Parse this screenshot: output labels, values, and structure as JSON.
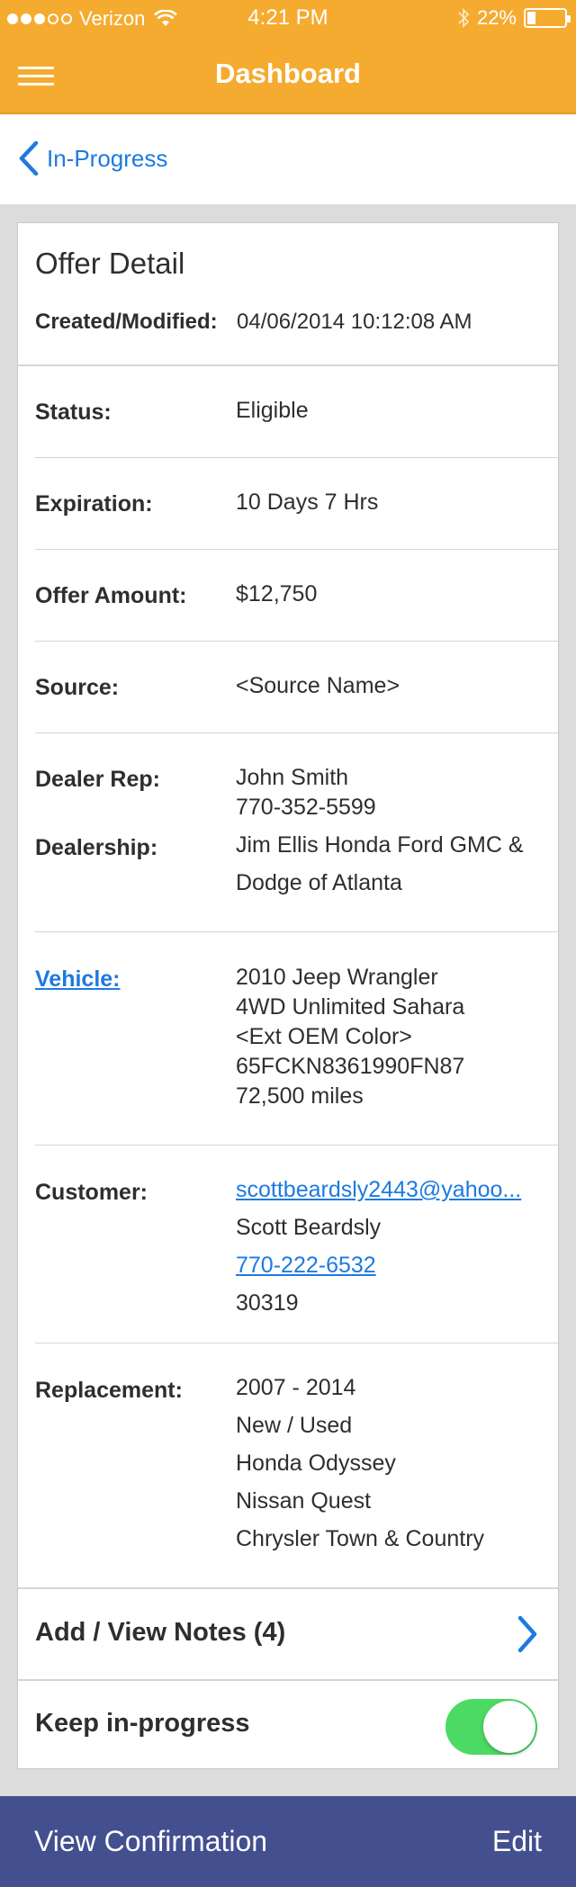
{
  "status_bar": {
    "carrier": "Verizon",
    "time": "4:21 PM",
    "battery": "22%",
    "battery_level": 0.22
  },
  "header": {
    "title": "Dashboard"
  },
  "back": {
    "label": "In-Progress"
  },
  "offer": {
    "title": "Offer Detail",
    "created_label": "Created/Modified:",
    "created_value": "04/06/2014  10:12:08 AM",
    "status_label": "Status:",
    "status_value": "Eligible",
    "expiration_label": "Expiration:",
    "expiration_value": "10 Days 7 Hrs",
    "amount_label": "Offer Amount:",
    "amount_value": "$12,750",
    "source_label": "Source:",
    "source_value": "<Source Name>",
    "dealer_rep_label": "Dealer Rep:",
    "dealer_rep_name": "John Smith",
    "dealer_rep_phone": "770-352-5599",
    "dealership_label": "Dealership:",
    "dealership_line1": "Jim Ellis Honda Ford GMC &",
    "dealership_line2": "Dodge of Atlanta",
    "vehicle_label": "Vehicle:",
    "vehicle_lines": [
      "2010 Jeep Wrangler",
      "4WD Unlimited Sahara",
      "<Ext OEM Color>",
      "65FCKN8361990FN87",
      "72,500 miles"
    ],
    "customer_label": "Customer:",
    "customer_email": "scottbeardsly2443@yahoo...",
    "customer_name": "Scott Beardsly",
    "customer_phone": "770-222-6532",
    "customer_zip": "30319",
    "replacement_label": "Replacement:",
    "replacement_lines": [
      "2007 - 2014",
      "New / Used",
      "Honda Odyssey",
      "Nissan Quest",
      "Chrysler Town & Country"
    ],
    "notes_label": "Add / View Notes (4)",
    "keep_label": "Keep in-progress",
    "keep_on": true
  },
  "footer": {
    "left_label": "View Confirmation",
    "right_label": "Edit"
  },
  "colors": {
    "header_bg": "#f5ab30",
    "link": "#1d7ae0",
    "footer_bg": "#434f8f",
    "toggle_on": "#4cd964"
  },
  "icons": [
    "wifi-icon",
    "bluetooth-icon",
    "battery-icon",
    "menu-icon",
    "chevron-left-icon",
    "chevron-right-icon"
  ]
}
